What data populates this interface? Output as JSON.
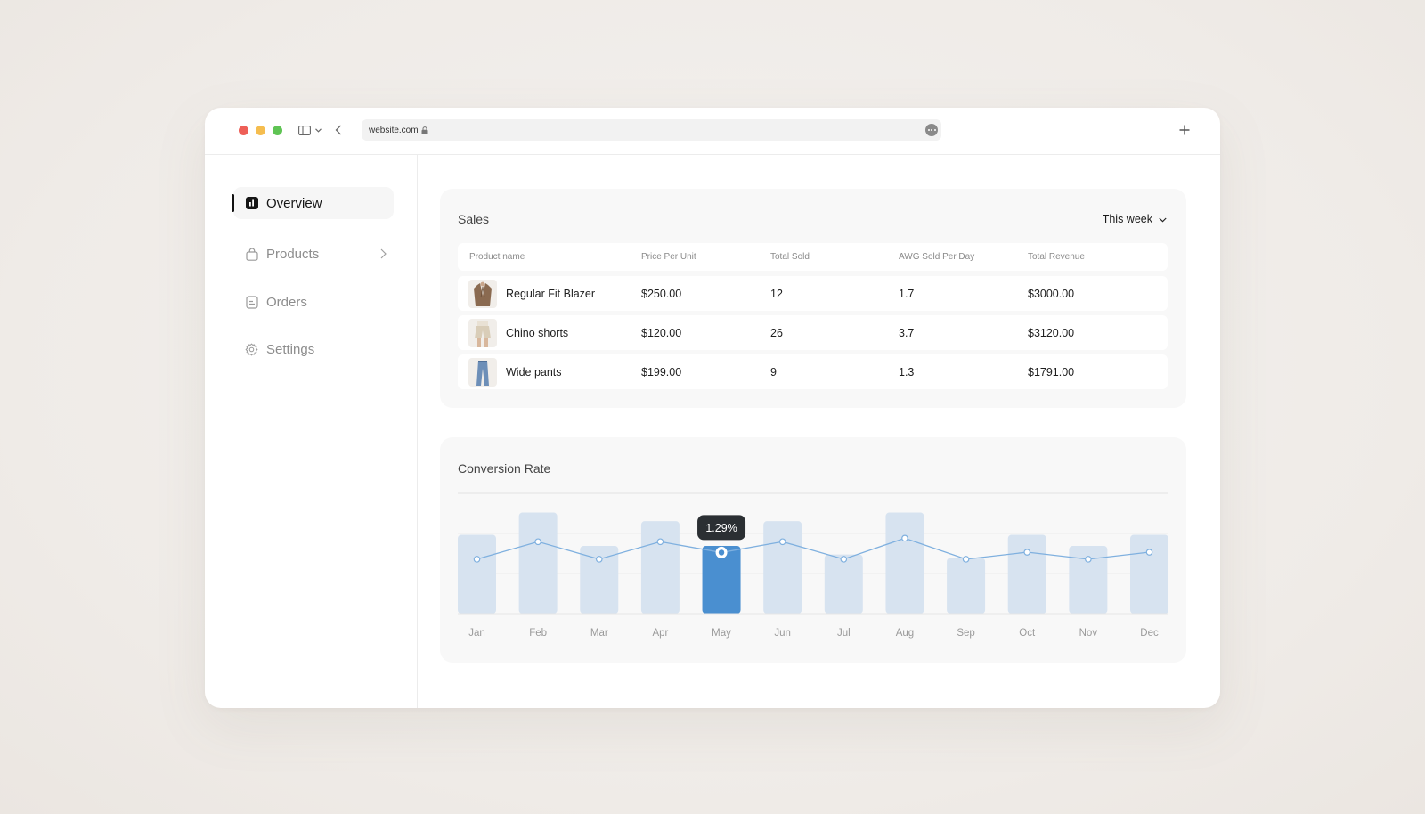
{
  "browser": {
    "url": "website.com"
  },
  "sidebar": {
    "items": [
      {
        "label": "Overview",
        "icon": "chart-square-icon",
        "active": true
      },
      {
        "label": "Products",
        "icon": "bag-icon",
        "active": false
      },
      {
        "label": "Orders",
        "icon": "receipt-icon",
        "active": false
      },
      {
        "label": "Settings",
        "icon": "gear-icon",
        "active": false
      }
    ]
  },
  "sales": {
    "title": "Sales",
    "range": "This week",
    "columns": [
      "Product name",
      "Price Per Unit",
      "Total Sold",
      "AWG Sold Per Day",
      "Total Revenue"
    ],
    "rows": [
      {
        "name": "Regular Fit Blazer",
        "price": "$250.00",
        "sold": "12",
        "avg": "1.7",
        "revenue": "$3000.00",
        "thumb": "blazer"
      },
      {
        "name": "Chino shorts",
        "price": "$120.00",
        "sold": "26",
        "avg": "3.7",
        "revenue": "$3120.00",
        "thumb": "shorts"
      },
      {
        "name": "Wide pants",
        "price": "$199.00",
        "sold": "9",
        "avg": "1.3",
        "revenue": "$1791.00",
        "thumb": "pants"
      }
    ]
  },
  "conversion": {
    "title": "Conversion Rate"
  },
  "chart_data": {
    "type": "bar",
    "categories": [
      "Jan",
      "Feb",
      "Mar",
      "Apr",
      "May",
      "Jun",
      "Jul",
      "Aug",
      "Sep",
      "Oct",
      "Nov",
      "Dec"
    ],
    "series": [
      {
        "values": [
          92,
          118,
          79,
          108,
          79,
          108,
          69,
          118,
          65,
          92,
          79,
          92
        ]
      },
      {
        "values": [
          1.1,
          1.6,
          1.1,
          1.6,
          1.29,
          1.6,
          1.1,
          1.7,
          1.1,
          1.3,
          1.1,
          1.3
        ]
      }
    ],
    "highlight_index": 4,
    "tooltip": "1.29%",
    "colors": {
      "bar": "#d7e3f0",
      "bar_active": "#4a8fd0",
      "line": "#7fb0df",
      "tooltip_bg": "#2b2f33"
    }
  }
}
